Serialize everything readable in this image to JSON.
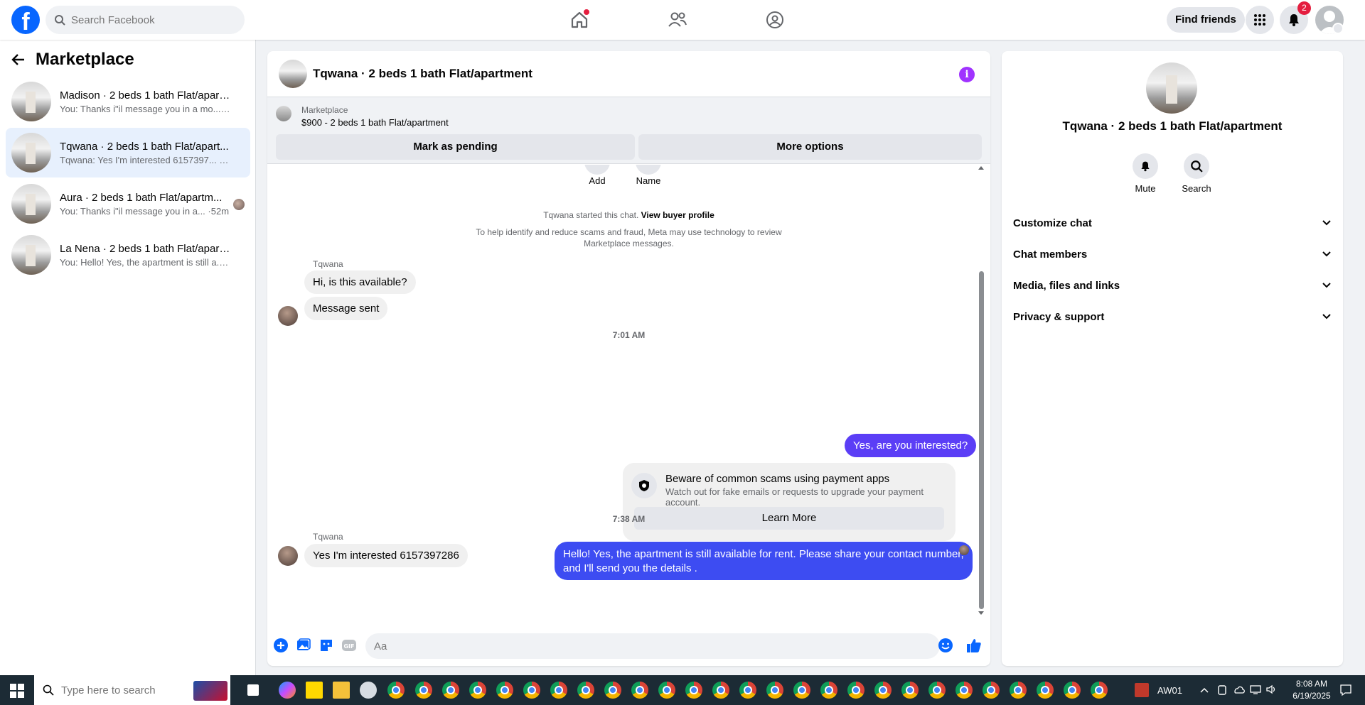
{
  "topbar": {
    "search_placeholder": "Search Facebook",
    "find_friends": "Find friends",
    "notification_count": "2"
  },
  "sidebar": {
    "title": "Marketplace",
    "conversations": [
      {
        "name": "Madison · 2 beds 1 bath Flat/apart...",
        "snippet": "You: Thanks i\"il message you in a mo... ·1m"
      },
      {
        "name": "Tqwana · 2 beds 1 bath Flat/apart...",
        "snippet": "Tqwana: Yes I'm interested 6157397... ·30m"
      },
      {
        "name": "Aura · 2 beds 1 bath Flat/apartm...",
        "snippet": "You: Thanks i\"il message you in a... ·52m"
      },
      {
        "name": "La Nena · 2 beds 1 bath Flat/apart...",
        "snippet": "You: Hello! Yes, the apartment is still a... ·1h"
      }
    ]
  },
  "chat": {
    "title": "Tqwana · 2 beds 1 bath Flat/apartment",
    "listing_source": "Marketplace",
    "listing_price": "$900 - 2 beds 1 bath Flat/apartment",
    "mark_pending": "Mark as pending",
    "more_options": "More options",
    "add_label": "Add",
    "name_label": "Name",
    "started_text": "Tqwana started this chat.",
    "view_profile": "View buyer profile",
    "safety_text_1": "To help identify and reduce scams and fraud, Meta may use technology to review",
    "safety_text_2": "Marketplace messages.",
    "sender_name": "Tqwana",
    "msg_1": "Hi, is this available?",
    "msg_2": "Message sent",
    "time_1": "7:01 AM",
    "out_1": "Yes, are you interested?",
    "scam_title": "Beware of common scams using payment apps",
    "scam_sub": "Watch out for fake emails or requests to upgrade your payment account.",
    "learn_more": "Learn More",
    "out_2_line1": "Hello! Yes, the apartment is still available for rent. Please share your contact number,",
    "out_2_line2": "and I'll send you the details .",
    "time_2": "7:38 AM",
    "sender_name_2": "Tqwana",
    "msg_3": "Yes I'm interested 6157397286",
    "input_placeholder": "Aa"
  },
  "right_panel": {
    "name": "Tqwana · 2 beds 1 bath Flat/apartment",
    "mute": "Mute",
    "search": "Search",
    "sections": [
      "Customize chat",
      "Chat members",
      "Media, files and links",
      "Privacy & support"
    ]
  },
  "taskbar": {
    "search_placeholder": "Type here to search",
    "tray_label": "AW01",
    "time": "8:08 AM",
    "date": "6/19/2025"
  },
  "colors": {
    "fb_blue": "#0866ff",
    "outgoing_bubble": "#5b3ef6",
    "info_purple": "#a033ff",
    "badge_red": "#e41e3f"
  }
}
